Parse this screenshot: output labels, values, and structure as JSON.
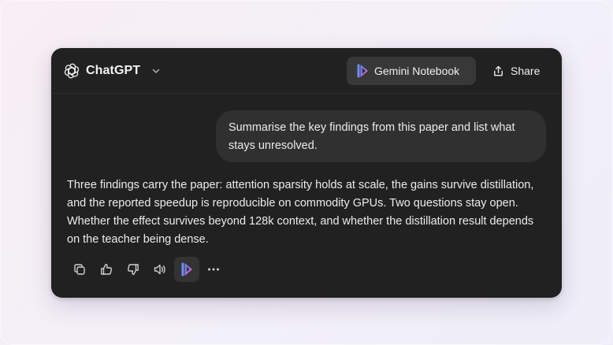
{
  "header": {
    "model_name": "ChatGPT",
    "gemini_button_label": "Gemini Notebook",
    "share_label": "Share"
  },
  "conversation": {
    "user_message": "Summarise the key findings from this paper and list what stays unresolved.",
    "assistant_message": "Three findings carry the paper: attention sparsity holds at scale, the gains survive distillation, and the reported speedup is reproducible on commodity GPUs. Two questions stay open. Whether the effect survives beyond 128k context, and whether the distillation result depends on the teacher being dense."
  },
  "actions": [
    "copy-icon",
    "thumbs-up-icon",
    "thumbs-down-icon",
    "read-aloud-icon",
    "gemini-notebook-icon",
    "more-icon"
  ],
  "colors": {
    "window_bg": "#212121",
    "bubble_bg": "#303030",
    "button_bg": "#383838",
    "text": "#ececec"
  }
}
